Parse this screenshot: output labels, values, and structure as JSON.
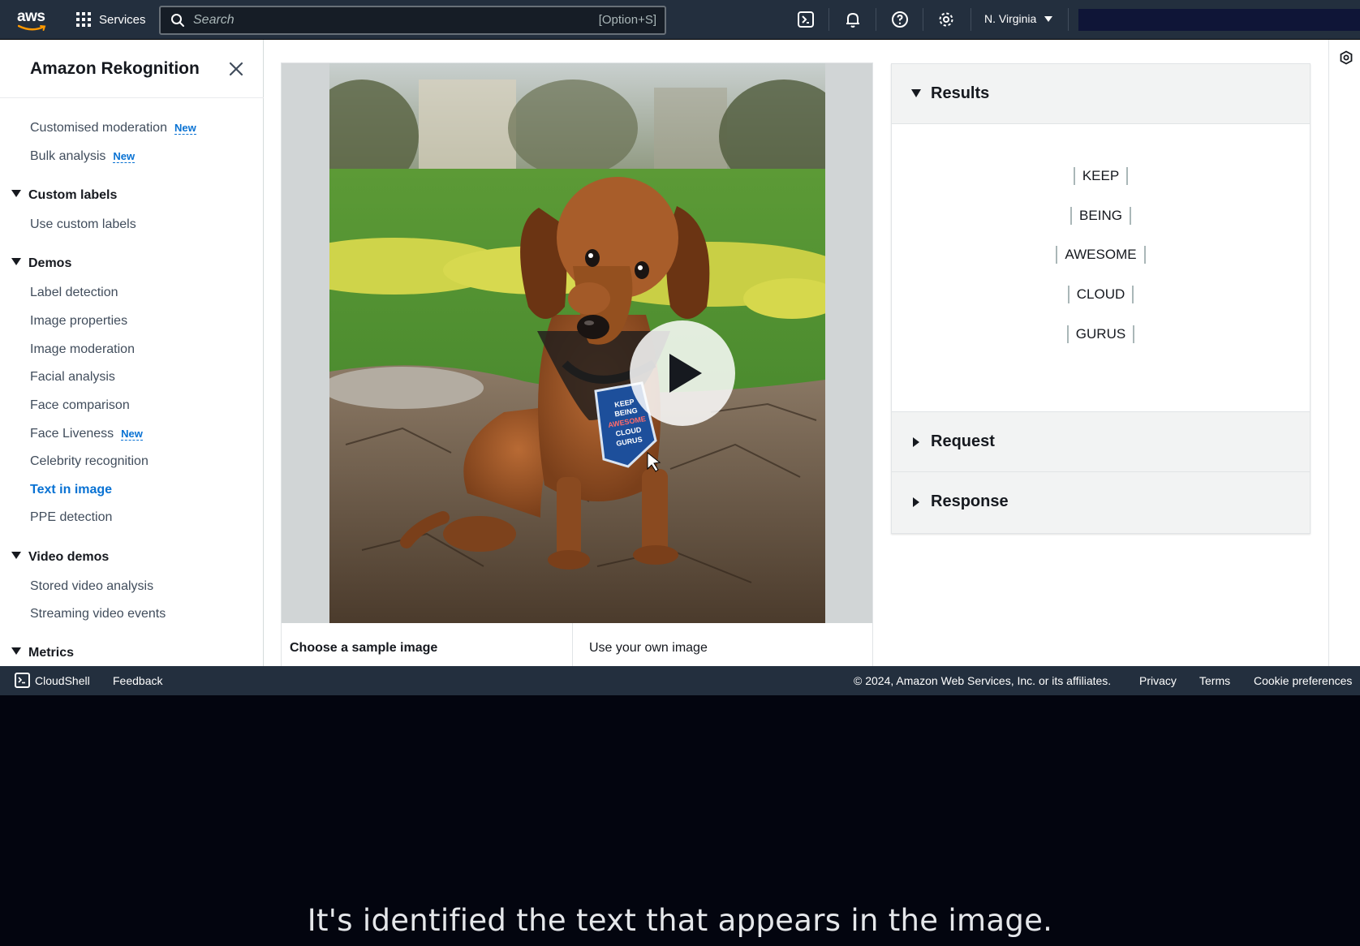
{
  "topnav": {
    "logo_text": "aws",
    "services_label": "Services",
    "search_placeholder": "Search",
    "search_shortcut": "[Option+S]",
    "region_label": "N. Virginia",
    "icons": [
      "cloudshell-icon",
      "bell-icon",
      "help-icon",
      "gear-icon"
    ]
  },
  "sidebar": {
    "title": "Amazon Rekognition",
    "new_badge": "New",
    "items": [
      {
        "label": "Customised moderation",
        "badge": "New"
      },
      {
        "label": "Bulk analysis",
        "badge": "New"
      }
    ],
    "sections": [
      {
        "label": "Custom labels",
        "items": [
          "Use custom labels"
        ]
      },
      {
        "label": "Demos",
        "items": [
          "Label detection",
          "Image properties",
          "Image moderation",
          "Facial analysis",
          "Face comparison",
          "Face Liveness",
          "Celebrity recognition",
          "Text in image",
          "PPE detection"
        ]
      },
      {
        "label": "Video demos",
        "items": [
          "Stored video analysis",
          "Streaming video events"
        ]
      },
      {
        "label": "Metrics",
        "items": []
      }
    ],
    "active_item": "Text in image"
  },
  "image_panel": {
    "sample_tab_label": "Choose a sample image",
    "own_tab_label": "Use your own image",
    "harness_badge_lines": [
      "KEEP",
      "BEING",
      "AWESOME",
      "CLOUD",
      "GURUS"
    ]
  },
  "results": {
    "title": "Results",
    "words": [
      "KEEP",
      "BEING",
      "AWESOME",
      "CLOUD",
      "GURUS"
    ],
    "request_label": "Request",
    "response_label": "Response"
  },
  "footer": {
    "cloudshell_label": "CloudShell",
    "feedback_label": "Feedback",
    "copyright": "© 2024, Amazon Web Services, Inc. or its affiliates.",
    "privacy_label": "Privacy",
    "terms_label": "Terms",
    "cookie_label": "Cookie preferences"
  },
  "caption": "It's identified the text that appears in the image.",
  "colors": {
    "nav_bg": "#232f3e",
    "link_active": "#0972d3",
    "caption_bg": "#03050f"
  }
}
